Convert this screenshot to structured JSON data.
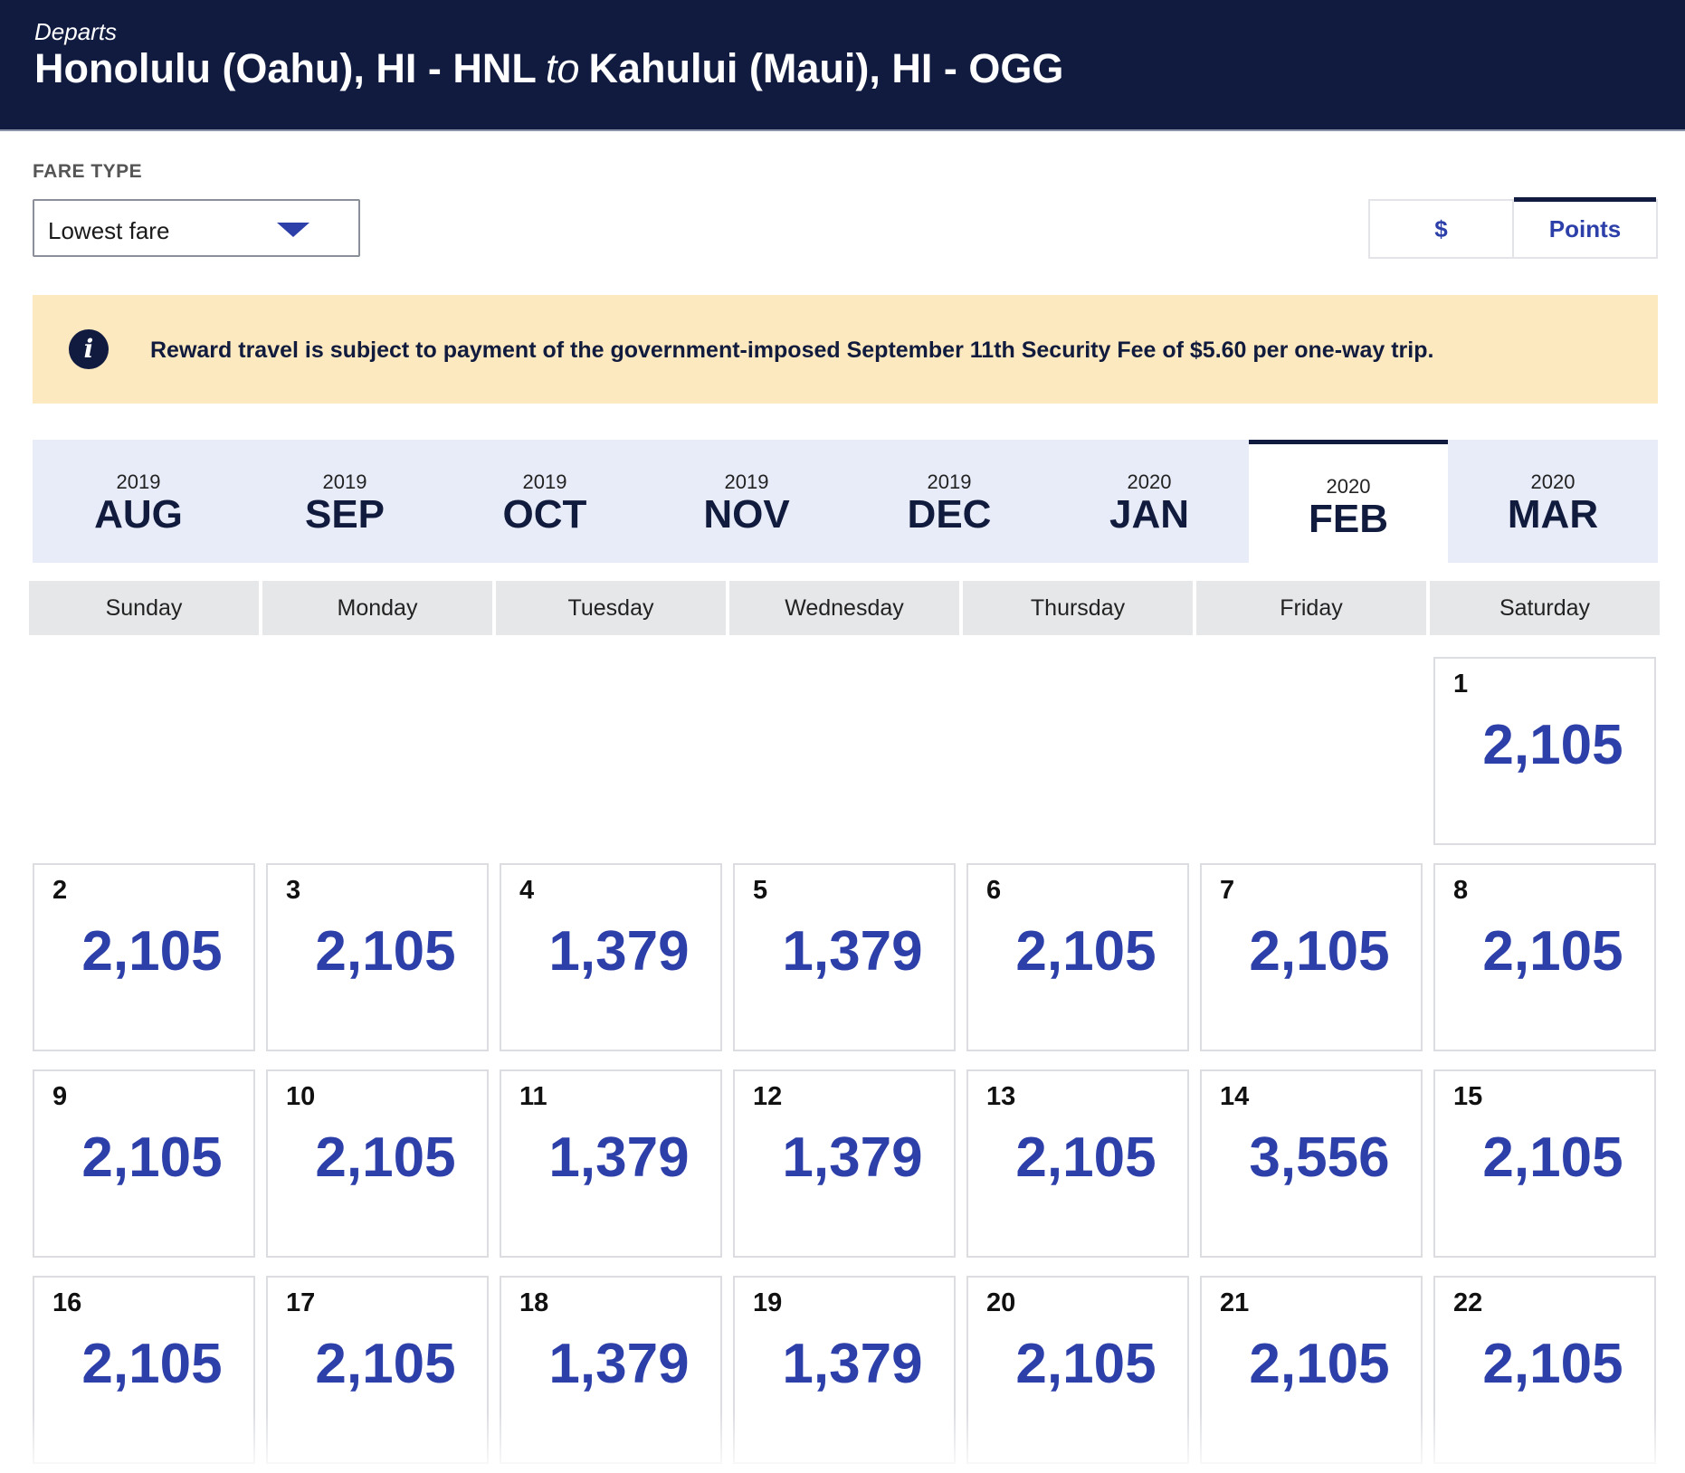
{
  "header": {
    "departs_label": "Departs",
    "origin": "Honolulu (Oahu), HI - HNL",
    "connector": "to",
    "destination": "Kahului (Maui), HI - OGG"
  },
  "fare_type": {
    "label": "FARE TYPE",
    "selected": "Lowest fare"
  },
  "currency_toggle": {
    "dollar_label": "$",
    "points_label": "Points",
    "active": "Points"
  },
  "notice": {
    "icon": "info-icon",
    "text": "Reward travel is subject to payment of the government-imposed September 11th Security Fee of $5.60 per one-way trip."
  },
  "months": [
    {
      "year": "2019",
      "month": "AUG"
    },
    {
      "year": "2019",
      "month": "SEP"
    },
    {
      "year": "2019",
      "month": "OCT"
    },
    {
      "year": "2019",
      "month": "NOV"
    },
    {
      "year": "2019",
      "month": "DEC"
    },
    {
      "year": "2020",
      "month": "JAN"
    },
    {
      "year": "2020",
      "month": "FEB",
      "active": true
    },
    {
      "year": "2020",
      "month": "MAR"
    }
  ],
  "weekdays": [
    "Sunday",
    "Monday",
    "Tuesday",
    "Wednesday",
    "Thursday",
    "Friday",
    "Saturday"
  ],
  "days": [
    {
      "day": "1",
      "points": "2,105"
    },
    {
      "day": "2",
      "points": "2,105"
    },
    {
      "day": "3",
      "points": "2,105"
    },
    {
      "day": "4",
      "points": "1,379"
    },
    {
      "day": "5",
      "points": "1,379"
    },
    {
      "day": "6",
      "points": "2,105"
    },
    {
      "day": "7",
      "points": "2,105"
    },
    {
      "day": "8",
      "points": "2,105"
    },
    {
      "day": "9",
      "points": "2,105"
    },
    {
      "day": "10",
      "points": "2,105"
    },
    {
      "day": "11",
      "points": "1,379"
    },
    {
      "day": "12",
      "points": "1,379"
    },
    {
      "day": "13",
      "points": "2,105"
    },
    {
      "day": "14",
      "points": "3,556"
    },
    {
      "day": "15",
      "points": "2,105"
    },
    {
      "day": "16",
      "points": "2,105"
    },
    {
      "day": "17",
      "points": "2,105"
    },
    {
      "day": "18",
      "points": "1,379"
    },
    {
      "day": "19",
      "points": "1,379"
    },
    {
      "day": "20",
      "points": "2,105"
    },
    {
      "day": "21",
      "points": "2,105"
    },
    {
      "day": "22",
      "points": "2,105"
    }
  ],
  "colors": {
    "header_bg": "#111b40",
    "accent": "#2d3fa8",
    "notice_bg": "#fde9c0",
    "month_bar_bg": "#e8ecf8"
  }
}
